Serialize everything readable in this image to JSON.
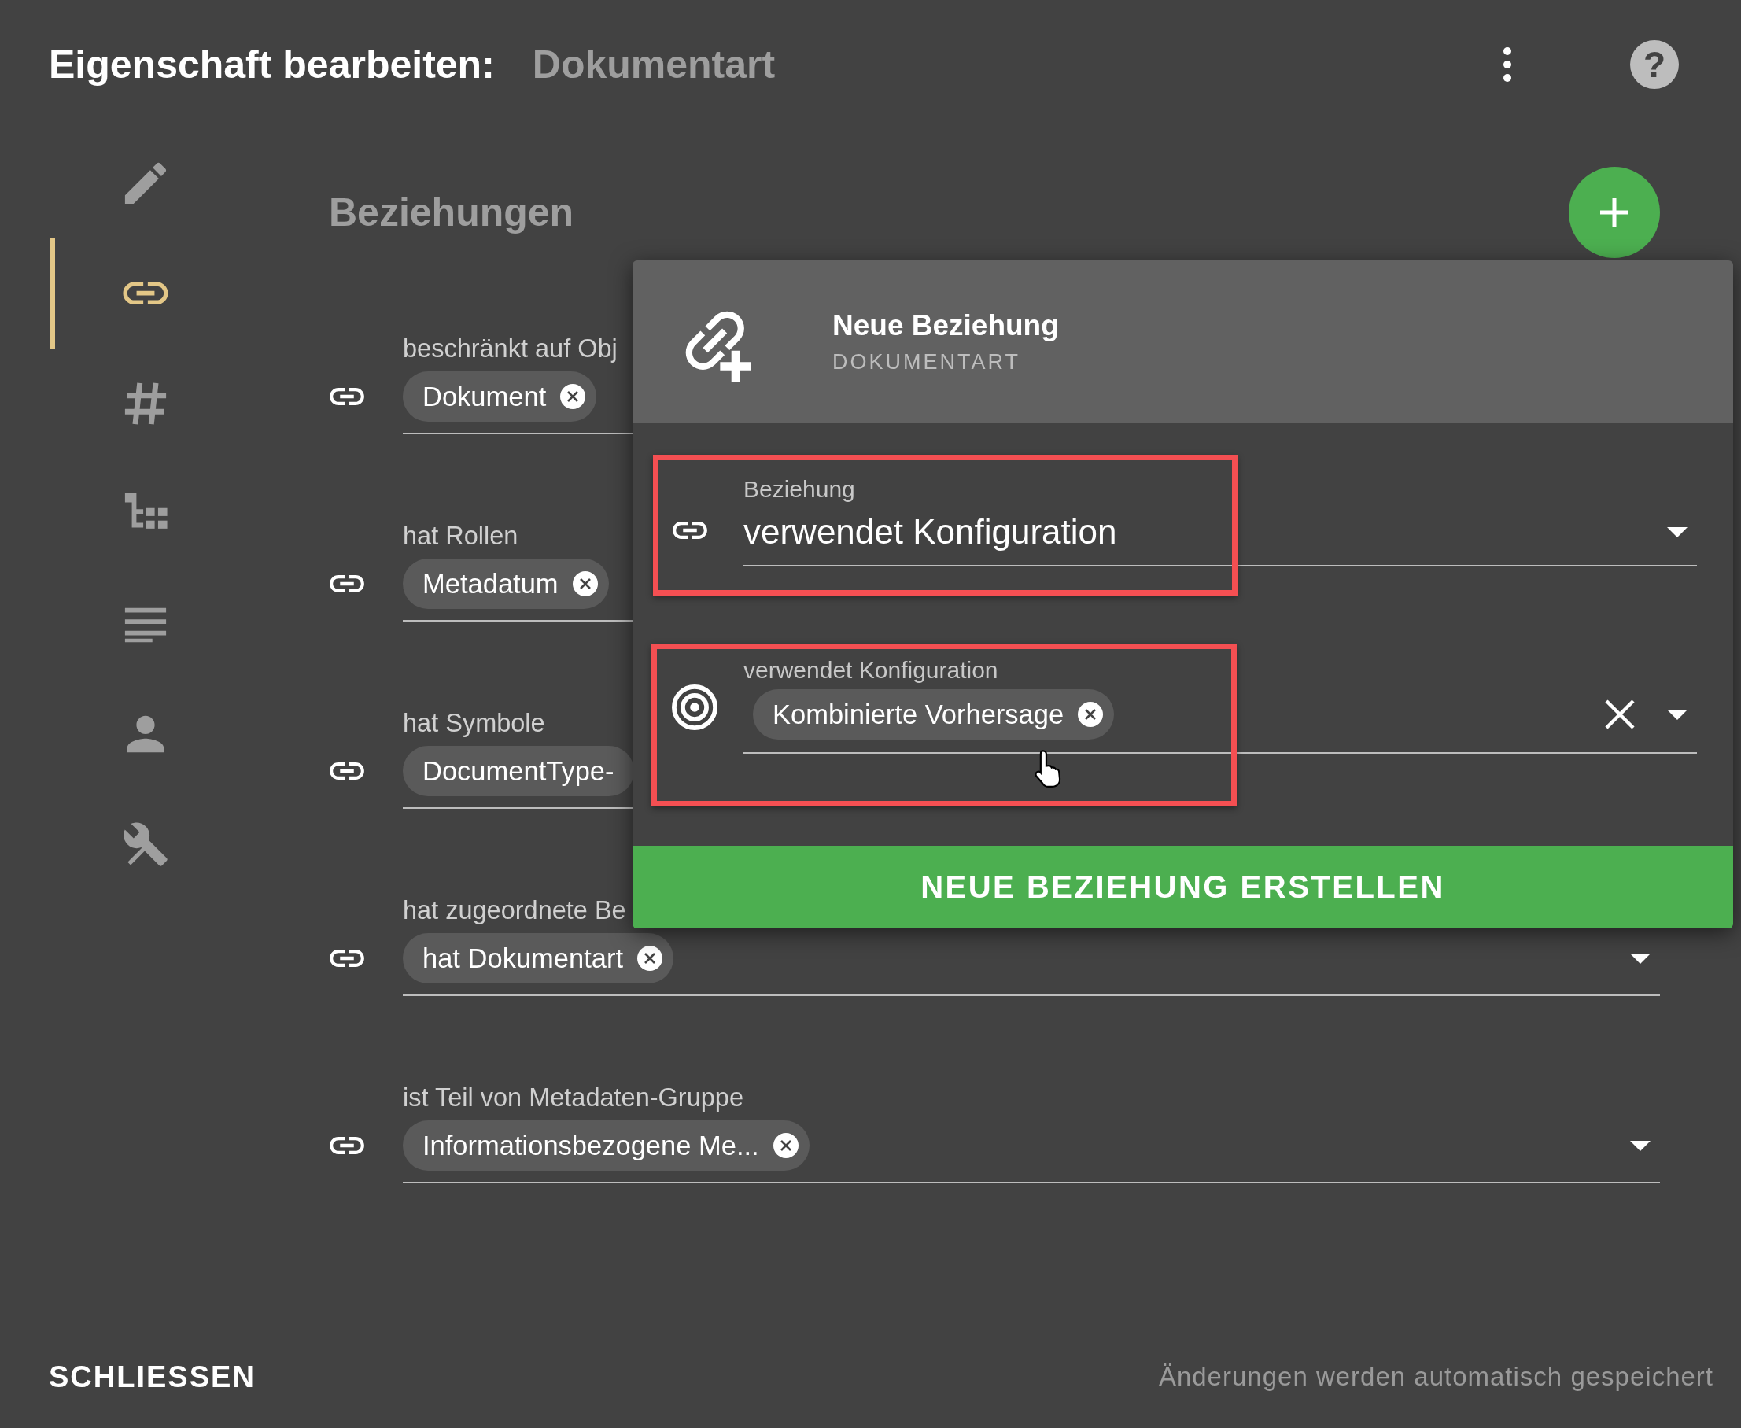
{
  "header": {
    "title": "Eigenschaft bearbeiten:",
    "subject": "Dokumentart",
    "help_icon": "?"
  },
  "sidebar": {
    "items": [
      {
        "kind": "edit",
        "selected": false
      },
      {
        "kind": "link",
        "selected": true
      },
      {
        "kind": "hash",
        "selected": false
      },
      {
        "kind": "tree",
        "selected": false
      },
      {
        "kind": "notes",
        "selected": false
      },
      {
        "kind": "person",
        "selected": false
      },
      {
        "kind": "tools",
        "selected": false
      }
    ]
  },
  "section": {
    "title": "Beziehungen"
  },
  "relations": [
    {
      "label": "beschränkt auf Obj",
      "chips": [
        {
          "text": "Dokument",
          "removable": true
        }
      ]
    },
    {
      "label": "hat Rollen",
      "chips": [
        {
          "text": "Metadatum",
          "removable": true
        }
      ]
    },
    {
      "label": "hat Symbole",
      "chips": [
        {
          "text": "DocumentType-",
          "removable": false
        }
      ]
    },
    {
      "label": "hat zugeordnete Be",
      "chips": [
        {
          "text": "hat Dokumentart",
          "removable": true
        }
      ],
      "dropdown": true
    },
    {
      "label": "ist Teil von Metadaten-Gruppe",
      "chips": [
        {
          "text": "Informationsbezogene Me...",
          "removable": true
        }
      ],
      "dropdown": true
    }
  ],
  "dialog": {
    "title": "Neue Beziehung",
    "subtitle": "DOKUMENTART",
    "fields": [
      {
        "kind": "select",
        "label": "Beziehung",
        "value": "verwendet Konfiguration",
        "highlighted": true
      },
      {
        "kind": "chips",
        "label": "verwendet Konfiguration",
        "chips": [
          {
            "text": "Kombinierte Vorhersage",
            "removable": true
          }
        ],
        "clearable": true,
        "highlighted": true
      }
    ],
    "submit": "NEUE BEZIEHUNG ERSTELLEN"
  },
  "footer": {
    "close": "SCHLIESSEN",
    "status": "Änderungen werden automatisch gespeichert"
  }
}
